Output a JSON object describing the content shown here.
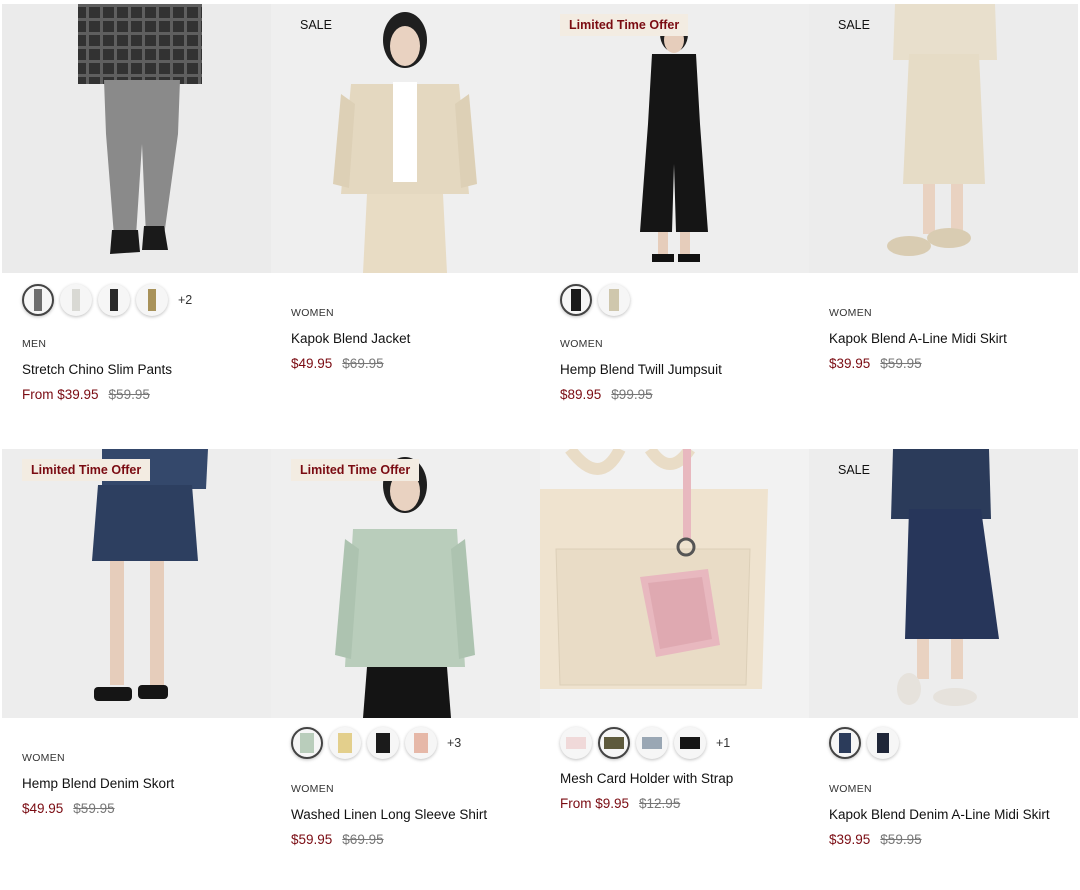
{
  "colors": {
    "sale_price": "#7a0b12",
    "lto_bg": "#f3ece2",
    "lto_text": "#7a0b12"
  },
  "products": [
    {
      "badge": "",
      "category": "MEN",
      "name": "Stretch Chino Slim Pants",
      "price": "From $39.95",
      "old_price": "$59.95",
      "swatch_colors": [
        "#6e6e6e",
        "#d9d9d4",
        "#2a2a2a",
        "#a8925a"
      ],
      "more": "+2"
    },
    {
      "badge": "SALE",
      "category": "WOMEN",
      "name": "Kapok Blend Jacket",
      "price": "$49.95",
      "old_price": "$69.95",
      "swatch_colors": [],
      "more": ""
    },
    {
      "badge": "Limited Time Offer",
      "category": "WOMEN",
      "name": "Hemp Blend Twill Jumpsuit",
      "price": "$89.95",
      "old_price": "$99.95",
      "swatch_colors": [
        "#1a1a1a",
        "#cfc7ad"
      ],
      "more": ""
    },
    {
      "badge": "SALE",
      "category": "WOMEN",
      "name": "Kapok Blend A-Line Midi Skirt",
      "price": "$39.95",
      "old_price": "$59.95",
      "swatch_colors": [],
      "more": ""
    },
    {
      "badge": "Limited Time Offer",
      "category": "WOMEN",
      "name": "Hemp Blend Denim Skort",
      "price": "$49.95",
      "old_price": "$59.95",
      "swatch_colors": [],
      "more": ""
    },
    {
      "badge": "Limited Time Offer",
      "category": "WOMEN",
      "name": "Washed Linen Long Sleeve Shirt",
      "price": "$59.95",
      "old_price": "$69.95",
      "swatch_colors": [
        "#b9cdbb",
        "#e3cf8c",
        "#1b1b1b",
        "#e6b8a8"
      ],
      "more": "+3"
    },
    {
      "badge": "",
      "category": "",
      "name": "Mesh Card Holder with Strap",
      "price": "From $9.95",
      "old_price": "$12.95",
      "swatch_colors": [
        "#f0d9d9",
        "#5e5a3c",
        "#9aa7b4",
        "#151515"
      ],
      "more": "+1"
    },
    {
      "badge": "SALE",
      "category": "WOMEN",
      "name": "Kapok Blend Denim A-Line Midi Skirt",
      "price": "$39.95",
      "old_price": "$59.95",
      "swatch_colors": [
        "#2b3b5a",
        "#1f2638"
      ],
      "more": ""
    }
  ]
}
